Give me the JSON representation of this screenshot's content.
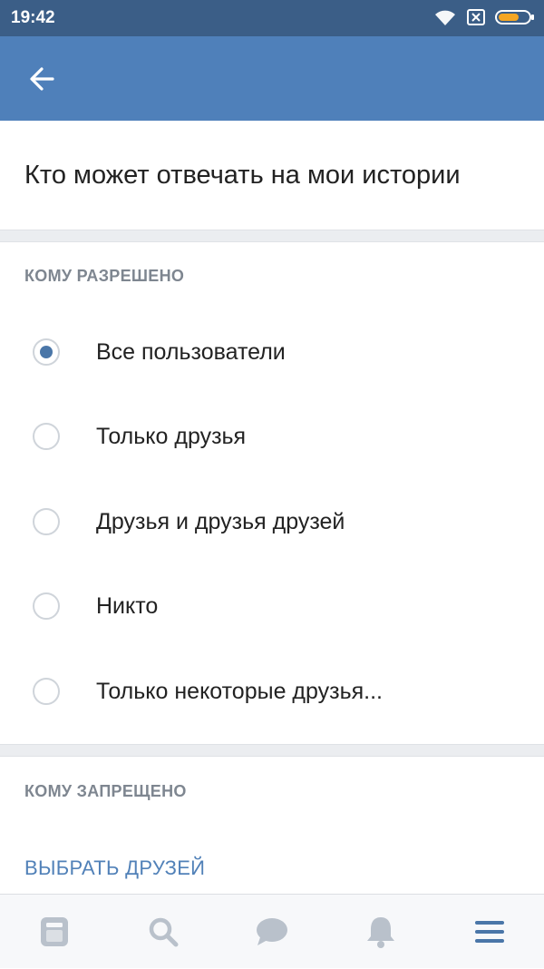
{
  "status_bar": {
    "time": "19:42",
    "icons": [
      "wifi-icon",
      "sim-off-icon",
      "battery-icon"
    ]
  },
  "app_bar": {
    "back_icon": "arrow-left-icon"
  },
  "page": {
    "title": "Кто может отвечать на мои истории"
  },
  "allowed": {
    "header": "КОМУ РАЗРЕШЕНО",
    "selected_index": 0,
    "options": [
      {
        "label": "Все пользователи",
        "checked": true
      },
      {
        "label": "Только друзья",
        "checked": false
      },
      {
        "label": "Друзья и друзья друзей",
        "checked": false
      },
      {
        "label": "Никто",
        "checked": false
      },
      {
        "label": "Только некоторые друзья...",
        "checked": false
      }
    ]
  },
  "denied": {
    "header": "КОМУ ЗАПРЕЩЕНО",
    "action_label": "ВЫБРАТЬ ДРУЗЕЙ"
  },
  "tab_bar": {
    "tabs": [
      {
        "icon": "news-icon"
      },
      {
        "icon": "search-icon"
      },
      {
        "icon": "messages-icon"
      },
      {
        "icon": "notifications-icon"
      },
      {
        "icon": "menu-icon"
      }
    ]
  },
  "colors": {
    "status_bar": "#3b5e87",
    "app_bar": "#4f80ba",
    "accent": "#4a76a8",
    "link": "#5181b8",
    "section_header": "#7e8690",
    "tab_icon": "#b9c1cb",
    "tab_icon_active": "#4a76a8"
  }
}
